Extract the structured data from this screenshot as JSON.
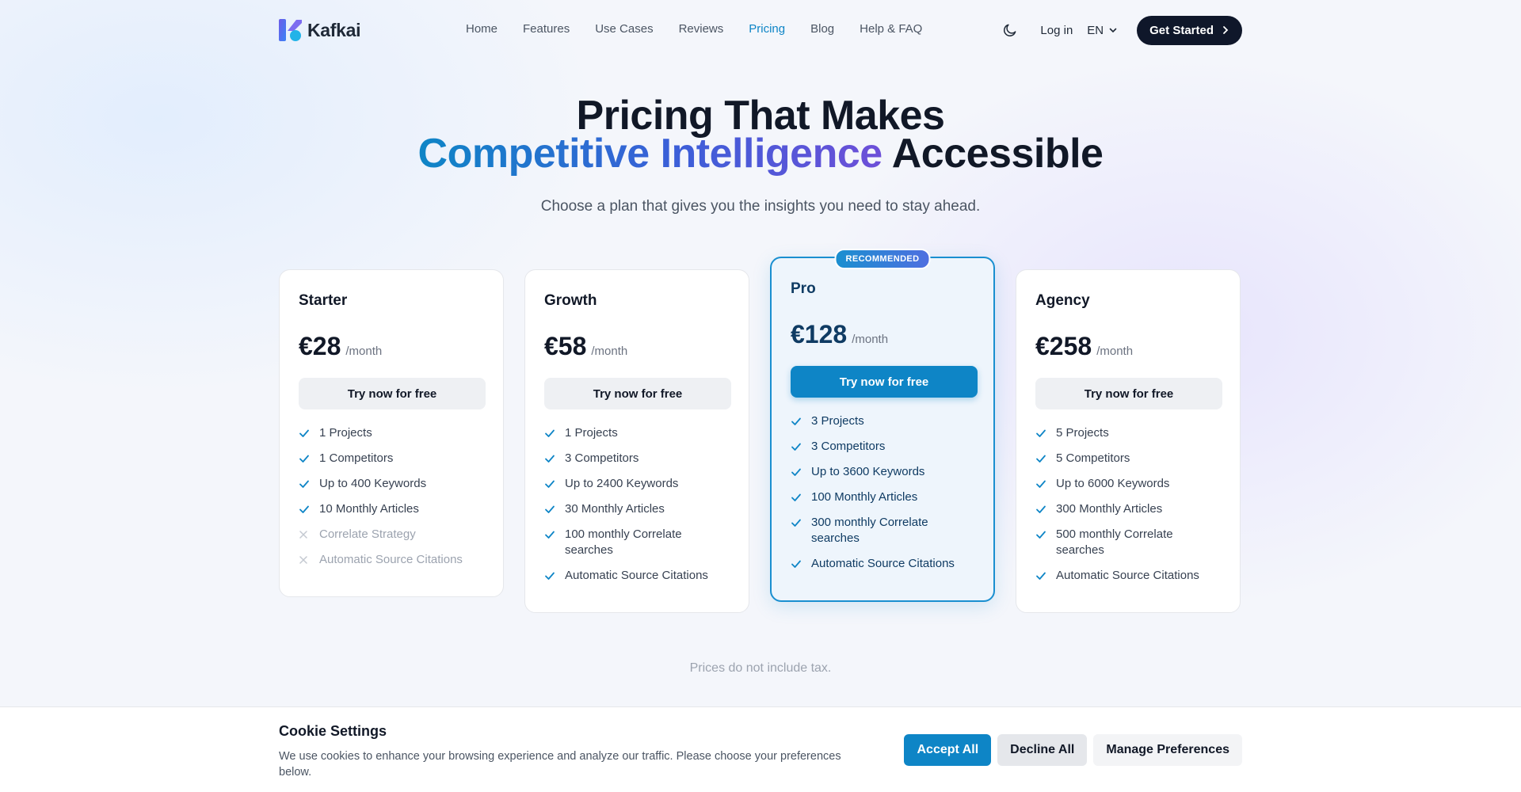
{
  "nav": {
    "logo_text": "Kafkai",
    "links": [
      {
        "label": "Home",
        "active": false
      },
      {
        "label": "Features",
        "active": false
      },
      {
        "label": "Use Cases",
        "active": false
      },
      {
        "label": "Reviews",
        "active": false
      },
      {
        "label": "Pricing",
        "active": true
      },
      {
        "label": "Blog",
        "active": false
      },
      {
        "label": "Help & FAQ",
        "active": false
      }
    ],
    "theme_icon": "moon-icon",
    "login_label": "Log in",
    "language": "EN",
    "cta_label": "Get Started"
  },
  "hero": {
    "title_line1": "Pricing That Makes",
    "title_line2_highlight": "Competitive Intelligence",
    "title_line2_rest": "Accessible",
    "subtitle": "Choose a plan that gives you the insights you need to stay ahead."
  },
  "plans": [
    {
      "name": "Starter",
      "price": "€28",
      "period": "/month",
      "button": "Try now for free",
      "recommended": false,
      "features": [
        {
          "text": "1 Projects",
          "included": true
        },
        {
          "text": "1 Competitors",
          "included": true
        },
        {
          "text": "Up to 400 Keywords",
          "included": true
        },
        {
          "text": "10 Monthly Articles",
          "included": true
        },
        {
          "text": "Correlate Strategy",
          "included": false
        },
        {
          "text": "Automatic Source Citations",
          "included": false
        }
      ]
    },
    {
      "name": "Growth",
      "price": "€58",
      "period": "/month",
      "button": "Try now for free",
      "recommended": false,
      "features": [
        {
          "text": "1 Projects",
          "included": true
        },
        {
          "text": "3 Competitors",
          "included": true
        },
        {
          "text": "Up to 2400 Keywords",
          "included": true
        },
        {
          "text": "30 Monthly Articles",
          "included": true
        },
        {
          "text": "100 monthly Correlate searches",
          "included": true
        },
        {
          "text": "Automatic Source Citations",
          "included": true
        }
      ]
    },
    {
      "name": "Pro",
      "price": "€128",
      "period": "/month",
      "button": "Try now for free",
      "recommended": true,
      "badge": "RECOMMENDED",
      "features": [
        {
          "text": "3 Projects",
          "included": true
        },
        {
          "text": "3 Competitors",
          "included": true
        },
        {
          "text": "Up to 3600 Keywords",
          "included": true
        },
        {
          "text": "100 Monthly Articles",
          "included": true
        },
        {
          "text": "300 monthly Correlate searches",
          "included": true
        },
        {
          "text": "Automatic Source Citations",
          "included": true
        }
      ]
    },
    {
      "name": "Agency",
      "price": "€258",
      "period": "/month",
      "button": "Try now for free",
      "recommended": false,
      "features": [
        {
          "text": "5 Projects",
          "included": true
        },
        {
          "text": "5 Competitors",
          "included": true
        },
        {
          "text": "Up to 6000 Keywords",
          "included": true
        },
        {
          "text": "300 Monthly Articles",
          "included": true
        },
        {
          "text": "500 monthly Correlate searches",
          "included": true
        },
        {
          "text": "Automatic Source Citations",
          "included": true
        }
      ]
    }
  ],
  "tax_note": "Prices do not include tax.",
  "cookie": {
    "title": "Cookie Settings",
    "text": "We use cookies to enhance your browsing experience and analyze our traffic. Please choose your preferences below.",
    "accept_label": "Accept All",
    "decline_label": "Decline All",
    "manage_label": "Manage Preferences"
  },
  "colors": {
    "accent": "#0e85c6",
    "dark": "#0f172a",
    "pro_border": "#1a8fd0"
  }
}
